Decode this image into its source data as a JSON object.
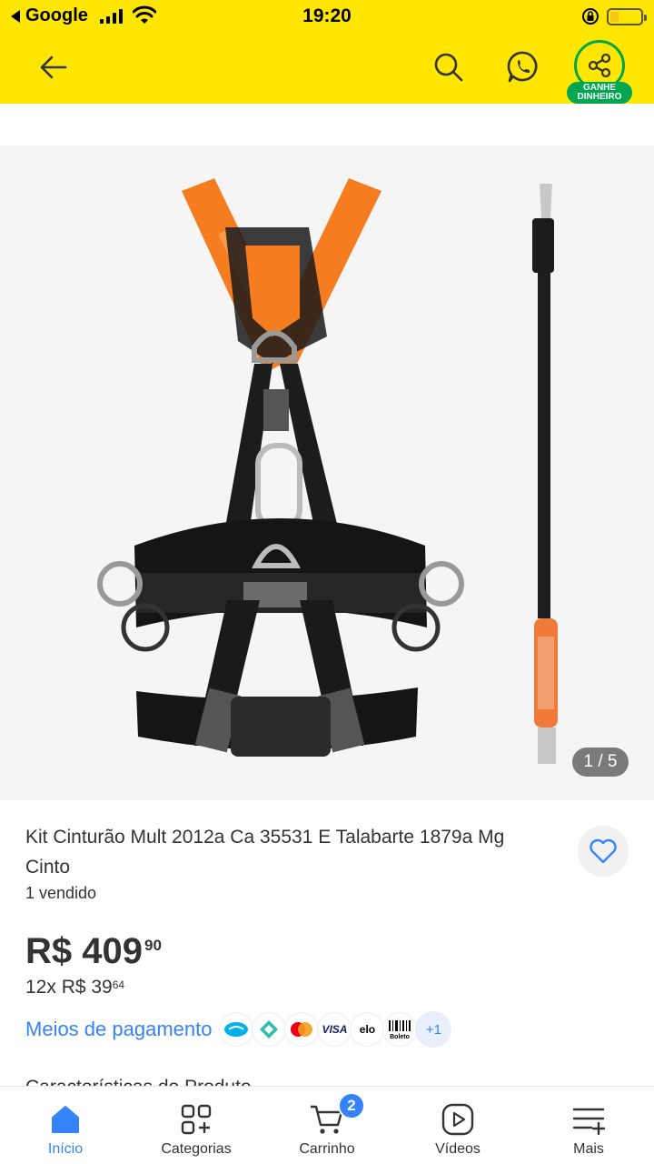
{
  "status_bar": {
    "back_app": "Google",
    "time": "19:20"
  },
  "header": {
    "share_badge_line1": "GANHE",
    "share_badge_line2": "DINHEIRO",
    "accent": "#ffe600",
    "share_accent": "#00a650",
    "icons": [
      "back-arrow-icon",
      "search-icon",
      "whatsapp-icon",
      "share-icon"
    ]
  },
  "gallery": {
    "counter": "1 / 5"
  },
  "product": {
    "title": "Kit Cinturão Mult 2012a Ca 35531 E Talabarte 1879a Mg Cinto",
    "sold": "1 vendido",
    "price_main": "R$ 409",
    "price_cents": "90",
    "installment_main": "12x R$ 39",
    "installment_cents": "64"
  },
  "payment": {
    "link": "Meios de pagamento",
    "methods": [
      "mercadopago",
      "pix",
      "mastercard",
      "VISA",
      "elo",
      "Boleto"
    ],
    "more": "+1",
    "link_color": "#3483fa"
  },
  "next_section_peek": "Características do Produto",
  "bottom_nav": {
    "items": [
      {
        "label": "Início",
        "icon": "home-icon"
      },
      {
        "label": "Categorias",
        "icon": "categories-icon"
      },
      {
        "label": "Carrinho",
        "icon": "cart-icon"
      },
      {
        "label": "Vídeos",
        "icon": "videos-icon"
      },
      {
        "label": "Mais",
        "icon": "menu-icon"
      }
    ],
    "cart_count": "2"
  }
}
